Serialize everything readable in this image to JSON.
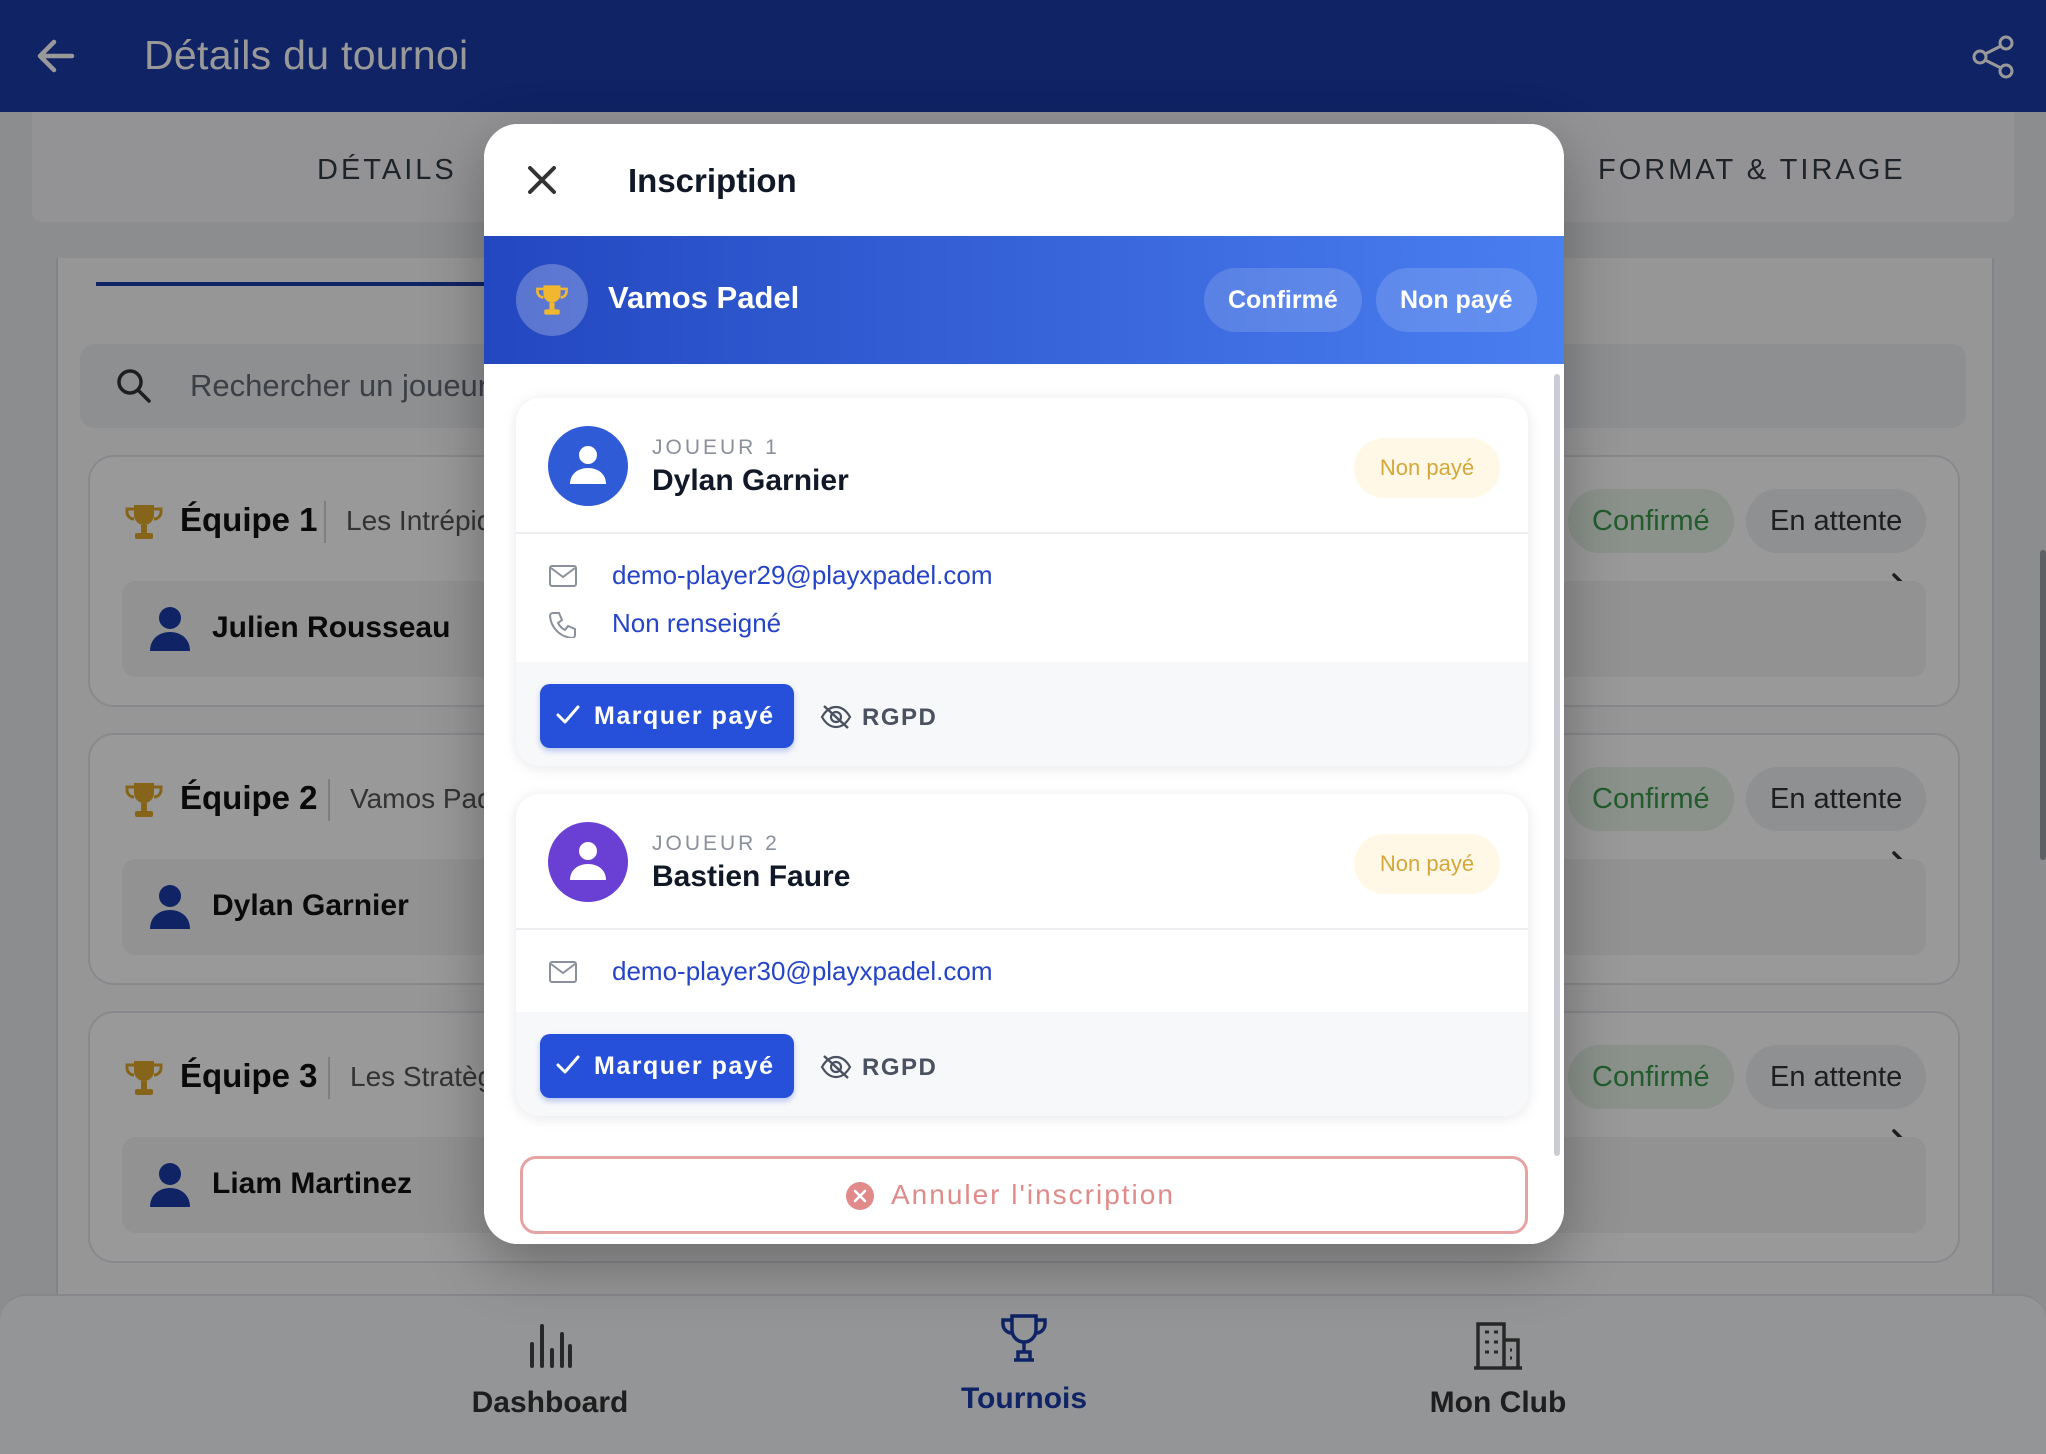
{
  "appbar": {
    "title": "Détails du tournoi"
  },
  "tabs": [
    {
      "label": "DÉTAILS"
    },
    {
      "label": "FORMAT & TIRAGE"
    }
  ],
  "search": {
    "placeholder": "Rechercher un joueur"
  },
  "teams": [
    {
      "name": "Équipe 1",
      "subtitle": "Les Intrépides",
      "status": "Confirmé",
      "payment": "En attente",
      "player": "Julien Rousseau"
    },
    {
      "name": "Équipe 2",
      "subtitle": "Vamos Padel",
      "status": "Confirmé",
      "payment": "En attente",
      "player": "Dylan Garnier"
    },
    {
      "name": "Équipe 3",
      "subtitle": "Les Stratèges",
      "status": "Confirmé",
      "payment": "En attente",
      "player": "Liam Martinez"
    }
  ],
  "bottom_nav": [
    {
      "label": "Dashboard"
    },
    {
      "label": "Tournois"
    },
    {
      "label": "Mon Club"
    }
  ],
  "modal": {
    "title": "Inscription",
    "team_name": "Vamos Padel",
    "status_chip": "Confirmé",
    "payment_chip": "Non payé",
    "players": [
      {
        "label": "JOUEUR 1",
        "name": "Dylan Garnier",
        "payment": "Non payé",
        "email": "demo-player29@playxpadel.com",
        "phone": "Non renseigné",
        "avatar_color": "#2f5bd6"
      },
      {
        "label": "JOUEUR 2",
        "name": "Bastien Faure",
        "payment": "Non payé",
        "email": "demo-player30@playxpadel.com",
        "avatar_color": "#6a3fd4"
      }
    ],
    "mark_paid_label": "Marquer payé",
    "rgpd_label": "RGPD",
    "cancel_label": "Annuler l'inscription"
  },
  "colors": {
    "primary": "#1a3ba8",
    "accent": "#2650d9",
    "confirmed": "#3a9a4a",
    "unpaid": "#d4a73a",
    "danger": "#e08a8a"
  }
}
